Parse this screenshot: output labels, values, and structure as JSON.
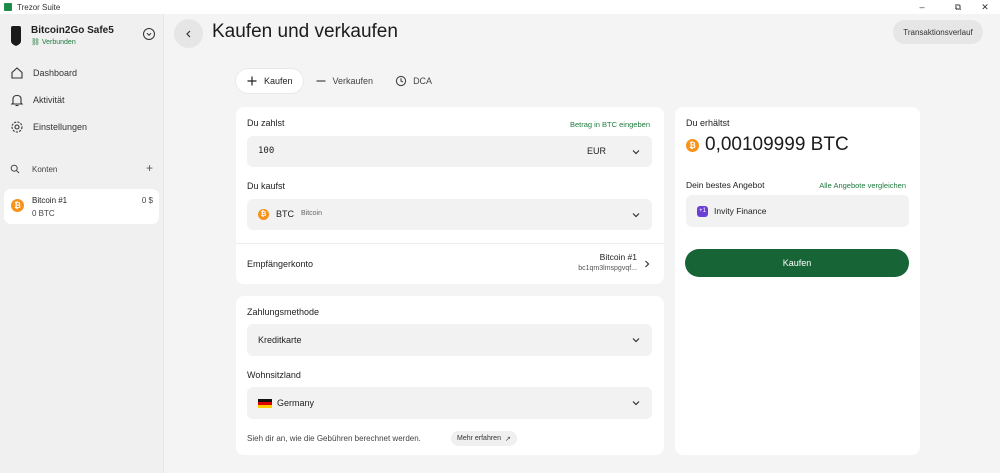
{
  "window": {
    "title": "Trezor Suite",
    "controls": [
      "–",
      "⧉",
      "✕"
    ]
  },
  "device": {
    "name": "Bitcoin2Go Safe5",
    "status": "Verbunden"
  },
  "nav": {
    "items": [
      {
        "label": "Dashboard",
        "icon": "home-icon"
      },
      {
        "label": "Aktivität",
        "icon": "bell-icon"
      },
      {
        "label": "Einstellungen",
        "icon": "gear-icon"
      }
    ]
  },
  "accounts": {
    "label": "Konten",
    "list": [
      {
        "name": "Bitcoin #1",
        "balance": "0 BTC",
        "fiat": "0 $",
        "symbol": "₿"
      }
    ]
  },
  "header": {
    "title": "Kaufen und verkaufen",
    "history_label": "Transaktionsverlauf"
  },
  "tabs": [
    {
      "label": "Kaufen",
      "icon": "plus-icon",
      "active": true
    },
    {
      "label": "Verkaufen",
      "icon": "minus-icon",
      "active": false
    },
    {
      "label": "DCA",
      "icon": "clock-icon",
      "active": false
    }
  ],
  "form": {
    "pay_label": "Du zahlst",
    "pay_btc_link": "Betrag in BTC eingeben",
    "amount_value": "100",
    "currency": "EUR",
    "buy_label": "Du kaufst",
    "coin_symbol": "BTC",
    "coin_name": "Bitcoin",
    "receiver_label": "Empfängerkonto",
    "receiver_account": "Bitcoin #1",
    "receiver_address": "bc1qm3lmspgvqf...",
    "payment_label": "Zahlungsmethode",
    "payment_value": "Kreditkarte",
    "country_label": "Wohnsitzland",
    "country_value": "Germany",
    "fee_text": "Sieh dir an, wie die Gebühren berechnet werden.",
    "more_label": "Mehr erfahren"
  },
  "offer": {
    "receive_label": "Du erhältst",
    "receive_amount": "0,00109999 BTC",
    "best_offer_label": "Dein bestes Angebot",
    "compare_link": "Alle Angebote vergleichen",
    "provider": "Invity Finance",
    "buy_button": "Kaufen"
  },
  "colors": {
    "accent_green": "#176436",
    "link_green": "#1f7a3f",
    "bitcoin_orange": "#f7931a",
    "provider_purple": "#6b3fd6"
  }
}
